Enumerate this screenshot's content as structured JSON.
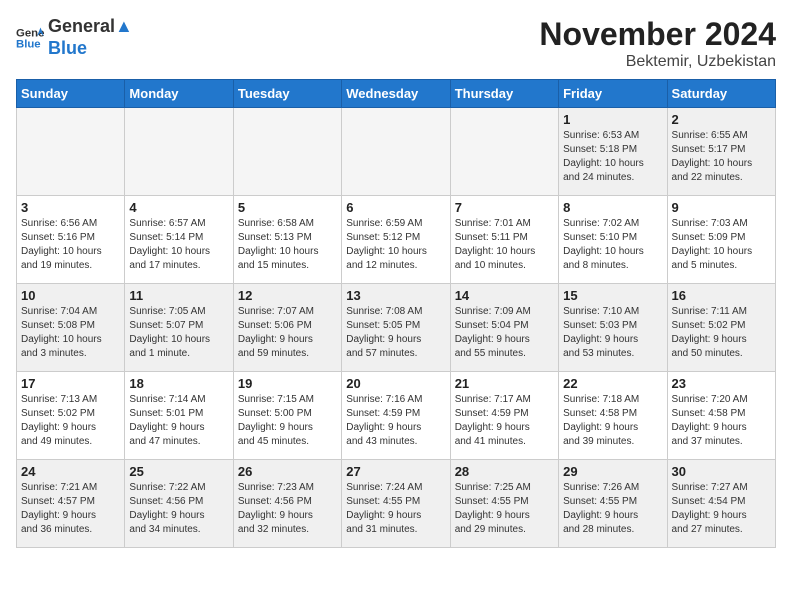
{
  "header": {
    "logo_general": "General",
    "logo_blue": "Blue",
    "month": "November 2024",
    "location": "Bektemir, Uzbekistan"
  },
  "days_of_week": [
    "Sunday",
    "Monday",
    "Tuesday",
    "Wednesday",
    "Thursday",
    "Friday",
    "Saturday"
  ],
  "weeks": [
    [
      {
        "day": "",
        "info": ""
      },
      {
        "day": "",
        "info": ""
      },
      {
        "day": "",
        "info": ""
      },
      {
        "day": "",
        "info": ""
      },
      {
        "day": "",
        "info": ""
      },
      {
        "day": "1",
        "info": "Sunrise: 6:53 AM\nSunset: 5:18 PM\nDaylight: 10 hours\nand 24 minutes."
      },
      {
        "day": "2",
        "info": "Sunrise: 6:55 AM\nSunset: 5:17 PM\nDaylight: 10 hours\nand 22 minutes."
      }
    ],
    [
      {
        "day": "3",
        "info": "Sunrise: 6:56 AM\nSunset: 5:16 PM\nDaylight: 10 hours\nand 19 minutes."
      },
      {
        "day": "4",
        "info": "Sunrise: 6:57 AM\nSunset: 5:14 PM\nDaylight: 10 hours\nand 17 minutes."
      },
      {
        "day": "5",
        "info": "Sunrise: 6:58 AM\nSunset: 5:13 PM\nDaylight: 10 hours\nand 15 minutes."
      },
      {
        "day": "6",
        "info": "Sunrise: 6:59 AM\nSunset: 5:12 PM\nDaylight: 10 hours\nand 12 minutes."
      },
      {
        "day": "7",
        "info": "Sunrise: 7:01 AM\nSunset: 5:11 PM\nDaylight: 10 hours\nand 10 minutes."
      },
      {
        "day": "8",
        "info": "Sunrise: 7:02 AM\nSunset: 5:10 PM\nDaylight: 10 hours\nand 8 minutes."
      },
      {
        "day": "9",
        "info": "Sunrise: 7:03 AM\nSunset: 5:09 PM\nDaylight: 10 hours\nand 5 minutes."
      }
    ],
    [
      {
        "day": "10",
        "info": "Sunrise: 7:04 AM\nSunset: 5:08 PM\nDaylight: 10 hours\nand 3 minutes."
      },
      {
        "day": "11",
        "info": "Sunrise: 7:05 AM\nSunset: 5:07 PM\nDaylight: 10 hours\nand 1 minute."
      },
      {
        "day": "12",
        "info": "Sunrise: 7:07 AM\nSunset: 5:06 PM\nDaylight: 9 hours\nand 59 minutes."
      },
      {
        "day": "13",
        "info": "Sunrise: 7:08 AM\nSunset: 5:05 PM\nDaylight: 9 hours\nand 57 minutes."
      },
      {
        "day": "14",
        "info": "Sunrise: 7:09 AM\nSunset: 5:04 PM\nDaylight: 9 hours\nand 55 minutes."
      },
      {
        "day": "15",
        "info": "Sunrise: 7:10 AM\nSunset: 5:03 PM\nDaylight: 9 hours\nand 53 minutes."
      },
      {
        "day": "16",
        "info": "Sunrise: 7:11 AM\nSunset: 5:02 PM\nDaylight: 9 hours\nand 50 minutes."
      }
    ],
    [
      {
        "day": "17",
        "info": "Sunrise: 7:13 AM\nSunset: 5:02 PM\nDaylight: 9 hours\nand 49 minutes."
      },
      {
        "day": "18",
        "info": "Sunrise: 7:14 AM\nSunset: 5:01 PM\nDaylight: 9 hours\nand 47 minutes."
      },
      {
        "day": "19",
        "info": "Sunrise: 7:15 AM\nSunset: 5:00 PM\nDaylight: 9 hours\nand 45 minutes."
      },
      {
        "day": "20",
        "info": "Sunrise: 7:16 AM\nSunset: 4:59 PM\nDaylight: 9 hours\nand 43 minutes."
      },
      {
        "day": "21",
        "info": "Sunrise: 7:17 AM\nSunset: 4:59 PM\nDaylight: 9 hours\nand 41 minutes."
      },
      {
        "day": "22",
        "info": "Sunrise: 7:18 AM\nSunset: 4:58 PM\nDaylight: 9 hours\nand 39 minutes."
      },
      {
        "day": "23",
        "info": "Sunrise: 7:20 AM\nSunset: 4:58 PM\nDaylight: 9 hours\nand 37 minutes."
      }
    ],
    [
      {
        "day": "24",
        "info": "Sunrise: 7:21 AM\nSunset: 4:57 PM\nDaylight: 9 hours\nand 36 minutes."
      },
      {
        "day": "25",
        "info": "Sunrise: 7:22 AM\nSunset: 4:56 PM\nDaylight: 9 hours\nand 34 minutes."
      },
      {
        "day": "26",
        "info": "Sunrise: 7:23 AM\nSunset: 4:56 PM\nDaylight: 9 hours\nand 32 minutes."
      },
      {
        "day": "27",
        "info": "Sunrise: 7:24 AM\nSunset: 4:55 PM\nDaylight: 9 hours\nand 31 minutes."
      },
      {
        "day": "28",
        "info": "Sunrise: 7:25 AM\nSunset: 4:55 PM\nDaylight: 9 hours\nand 29 minutes."
      },
      {
        "day": "29",
        "info": "Sunrise: 7:26 AM\nSunset: 4:55 PM\nDaylight: 9 hours\nand 28 minutes."
      },
      {
        "day": "30",
        "info": "Sunrise: 7:27 AM\nSunset: 4:54 PM\nDaylight: 9 hours\nand 27 minutes."
      }
    ]
  ]
}
